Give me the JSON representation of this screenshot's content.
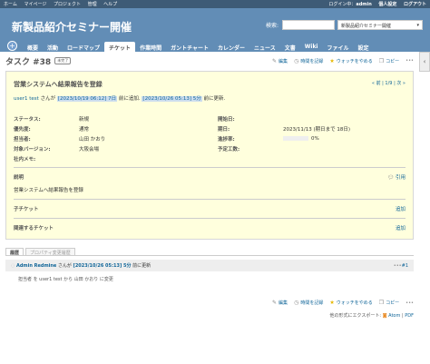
{
  "top_menu": {
    "left": [
      "ホーム",
      "マイページ",
      "プロジェクト",
      "管理",
      "ヘルプ"
    ],
    "logged_in_as": "ログイン中：",
    "user": "admin",
    "account": "個人設定",
    "logout": "ログアウト"
  },
  "header": {
    "title": "新製品紹介セミナー開催",
    "search_label": "検索:",
    "project_jump": "新製品紹介セミナー開催"
  },
  "main_menu": {
    "new_icon": "+",
    "tabs": [
      "概要",
      "活動",
      "ロードマップ",
      "チケット",
      "作業時間",
      "ガントチャート",
      "カレンダー",
      "ニュース",
      "文書",
      "Wiki",
      "ファイル",
      "設定"
    ],
    "selected_index": 3
  },
  "issue": {
    "title": "タスク #38",
    "status_badge": "未完了",
    "actions": {
      "edit": "編集",
      "log_time": "時間を記録",
      "watch": "ウォッチをやめる",
      "copy": "コピー",
      "more": "•••"
    },
    "subject": "営業システムへ結果報告を登録",
    "nav": "« 前 | 1/9 | 次 »",
    "author_prefix": "user1 test",
    "author_mid1": "さんが",
    "created": "[2023/10/19 06:12] 7日",
    "author_mid2": "前に追加.",
    "updated": "[2023/10/26 05:13] 5分",
    "author_mid3": "前に更新.",
    "attrs_left": [
      {
        "k": "ステータス:",
        "v": "新規"
      },
      {
        "k": "優先度:",
        "v": "通常"
      },
      {
        "k": "担当者:",
        "v": "山田 かおり"
      },
      {
        "k": "対象バージョン:",
        "v": "大阪会場"
      },
      {
        "k": "社内メモ:",
        "v": ""
      }
    ],
    "attrs_right": [
      {
        "k": "開始日:",
        "v": ""
      },
      {
        "k": "期日:",
        "v": "2023/11/13 (期日まで 18日)"
      },
      {
        "k": "進捗率:",
        "v": "0%"
      },
      {
        "k": "予定工数:",
        "v": ""
      }
    ],
    "progress": 0,
    "description_label": "説明",
    "quote": "引用",
    "description": "営業システムへ結果報告を登録",
    "subtasks_label": "子チケット",
    "related_label": "関連するチケット",
    "add": "追加"
  },
  "history": {
    "tabs": [
      "履歴",
      "プロパティ変更履歴"
    ],
    "journal_who": "Admin Redmine",
    "journal_mid": "さんが",
    "journal_when": "[2023/10/26 05:13] 5分",
    "journal_suffix": "前に更新",
    "journal_num": "#1",
    "detail": "担当者 を user1 test から 山田 かおり に変更"
  },
  "export": {
    "label": "他の形式にエクスポート:",
    "atom": "Atom",
    "pdf": "PDF"
  },
  "colors": {
    "top_bar": "#3e5b76",
    "header": "#628db6",
    "issue_bg": "#ffffdd",
    "link": "#116699"
  }
}
